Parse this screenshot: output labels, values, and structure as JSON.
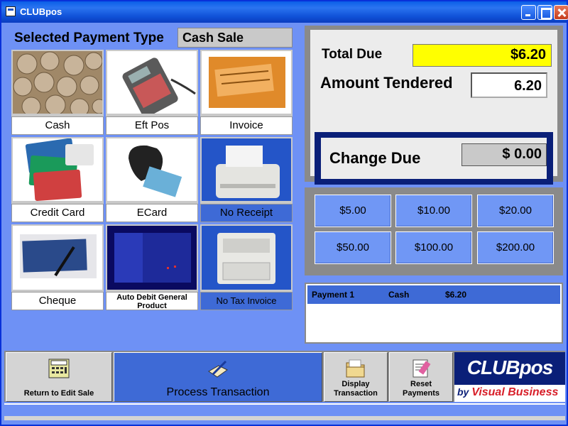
{
  "window": {
    "title": "CLUBpos"
  },
  "payment_type": {
    "label": "Selected Payment Type",
    "value": "Cash Sale"
  },
  "tiles": [
    {
      "label": "Cash",
      "icon": "coins-icon",
      "selected": false
    },
    {
      "label": "Eft Pos",
      "icon": "eftpos-terminal-icon",
      "selected": false
    },
    {
      "label": "Invoice",
      "icon": "invoice-document-icon",
      "selected": false
    },
    {
      "label": "Credit Card",
      "icon": "credit-cards-icon",
      "selected": false
    },
    {
      "label": "ECard",
      "icon": "card-reader-icon",
      "selected": false
    },
    {
      "label": "No Receipt",
      "icon": "receipt-printer-icon",
      "selected": true
    },
    {
      "label": "Cheque",
      "icon": "chequebook-icon",
      "selected": false
    },
    {
      "label": "Auto Debit General Product",
      "icon": "auto-debit-icon",
      "selected": false
    },
    {
      "label": "No Tax Invoice",
      "icon": "laser-printer-icon",
      "selected": true
    }
  ],
  "totals": {
    "total_due_label": "Total Due",
    "total_due_value": "$6.20",
    "amount_tendered_label": "Amount Tendered",
    "amount_tendered_value": "6.20",
    "change_due_label": "Change Due",
    "change_due_value": "$ 0.00"
  },
  "quick_amounts": [
    "$5.00",
    "$10.00",
    "$20.00",
    "$50.00",
    "$100.00",
    "$200.00"
  ],
  "payments": [
    {
      "name": "Payment 1",
      "type": "Cash",
      "amount": "$6.20"
    }
  ],
  "toolbar": {
    "return_label": "Return to Edit Sale",
    "process_label": "Process Transaction",
    "display_label_1": "Display",
    "display_label_2": "Transaction",
    "reset_label_1": "Reset",
    "reset_label_2": "Payments"
  },
  "logo": {
    "line1": "CLUBpos",
    "by": "by",
    "brand": "Visual Business"
  },
  "colors": {
    "background": "#6e91f5",
    "selected": "#3e6ad6",
    "total_highlight": "#ffff00",
    "frame": "#0a1f78"
  }
}
